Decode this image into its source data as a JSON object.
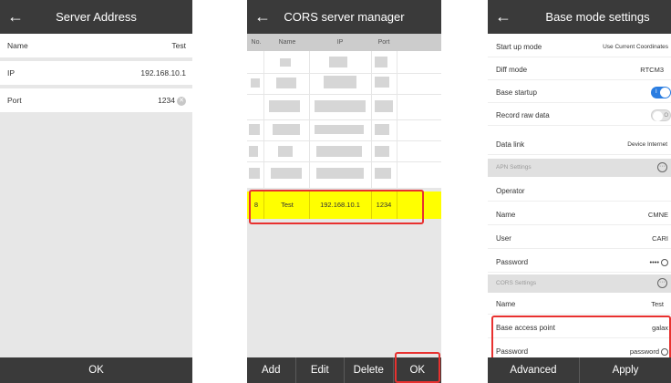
{
  "server_address": {
    "title": "Server Address",
    "fields": [
      {
        "label": "Name",
        "value": "Test"
      },
      {
        "label": "IP",
        "value": "192.168.10.1"
      },
      {
        "label": "Port",
        "value": "1234"
      }
    ],
    "ok_label": "OK"
  },
  "cors_manager": {
    "title": "CORS server manager",
    "columns": [
      "No.",
      "Name",
      "IP",
      "Port"
    ],
    "selected_row": {
      "no": "8",
      "name": "Test",
      "ip": "192.168.10.1",
      "port": "1234"
    },
    "buttons": [
      "Add",
      "Edit",
      "Delete",
      "OK"
    ]
  },
  "base_mode": {
    "title": "Base mode settings",
    "start_up_mode": {
      "label": "Start up mode",
      "value": "Use Current Coordinates"
    },
    "diff_mode": {
      "label": "Diff mode",
      "value": "RTCM3"
    },
    "base_startup": {
      "label": "Base startup",
      "on": true
    },
    "record_raw": {
      "label": "Record raw data",
      "on": false
    },
    "data_link": {
      "label": "Data link",
      "value": "Device Internet"
    },
    "apn_section": "APN Settings",
    "operator": {
      "label": "Operator"
    },
    "apn_name": {
      "label": "Name",
      "value": "CMNE"
    },
    "user": {
      "label": "User",
      "value": "CARI"
    },
    "apn_password": {
      "label": "Password",
      "value": "••••"
    },
    "cors_section": "CORS Settings",
    "cors_name": {
      "label": "Name",
      "value": "Test"
    },
    "access_point": {
      "label": "Base access point",
      "value": "galax"
    },
    "cors_password": {
      "label": "Password",
      "value": "password"
    },
    "advanced_label": "Advanced",
    "apply_label": "Apply"
  },
  "colors": {
    "titlebar": "#3a3a3a",
    "highlight": "#ffff00",
    "annotation": "#e8312f",
    "toggle_on": "#2a7de1"
  }
}
